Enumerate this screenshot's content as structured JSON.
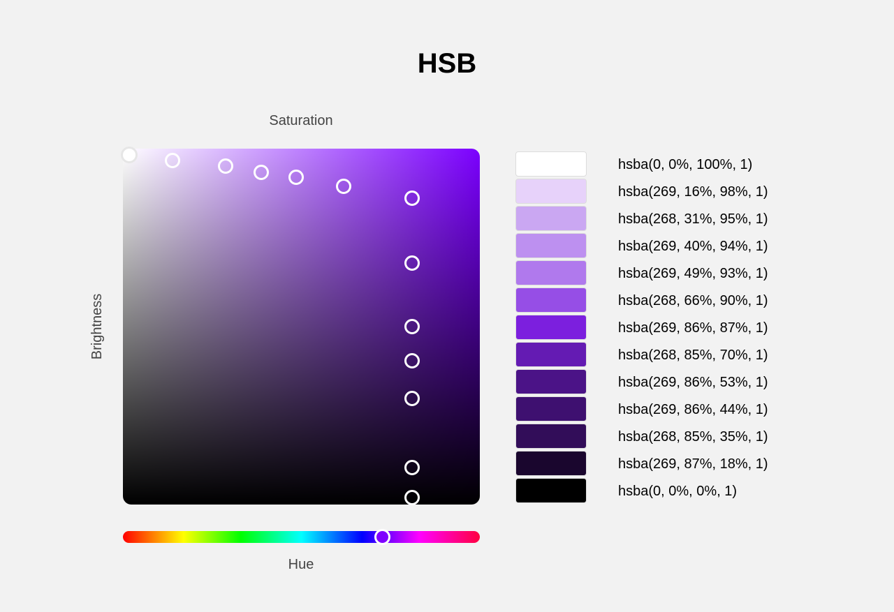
{
  "title": "HSB",
  "saturation_label": "Saturation",
  "brightness_label": "Brightness",
  "hue_label": "Hue",
  "hue_value": 269,
  "base_color": "#7f00ff",
  "swatches": [
    {
      "label": "hsba(0, 0%, 100%, 1)",
      "color": "#ffffff"
    },
    {
      "label": "hsba(269, 16%, 98%, 1)",
      "color": "#e7d2fa"
    },
    {
      "label": "hsba(268, 31%, 95%, 1)",
      "color": "#caa7f2"
    },
    {
      "label": "hsba(269, 40%, 94%, 1)",
      "color": "#bd90f0"
    },
    {
      "label": "hsba(269, 49%, 93%, 1)",
      "color": "#b079ed"
    },
    {
      "label": "hsba(268, 66%, 90%, 1)",
      "color": "#964ee6"
    },
    {
      "label": "hsba(269, 86%, 87%, 1)",
      "color": "#7c1fde"
    },
    {
      "label": "hsba(268, 85%, 70%, 1)",
      "color": "#641bb3"
    },
    {
      "label": "hsba(269, 86%, 53%, 1)",
      "color": "#4b1387"
    },
    {
      "label": "hsba(269, 86%, 44%, 1)",
      "color": "#3e1070"
    },
    {
      "label": "hsba(268, 85%, 35%, 1)",
      "color": "#320d59"
    },
    {
      "label": "hsba(269, 87%, 18%, 1)",
      "color": "#1a062e"
    },
    {
      "label": "hsba(0, 0%, 0%, 1)",
      "color": "#000000"
    }
  ]
}
